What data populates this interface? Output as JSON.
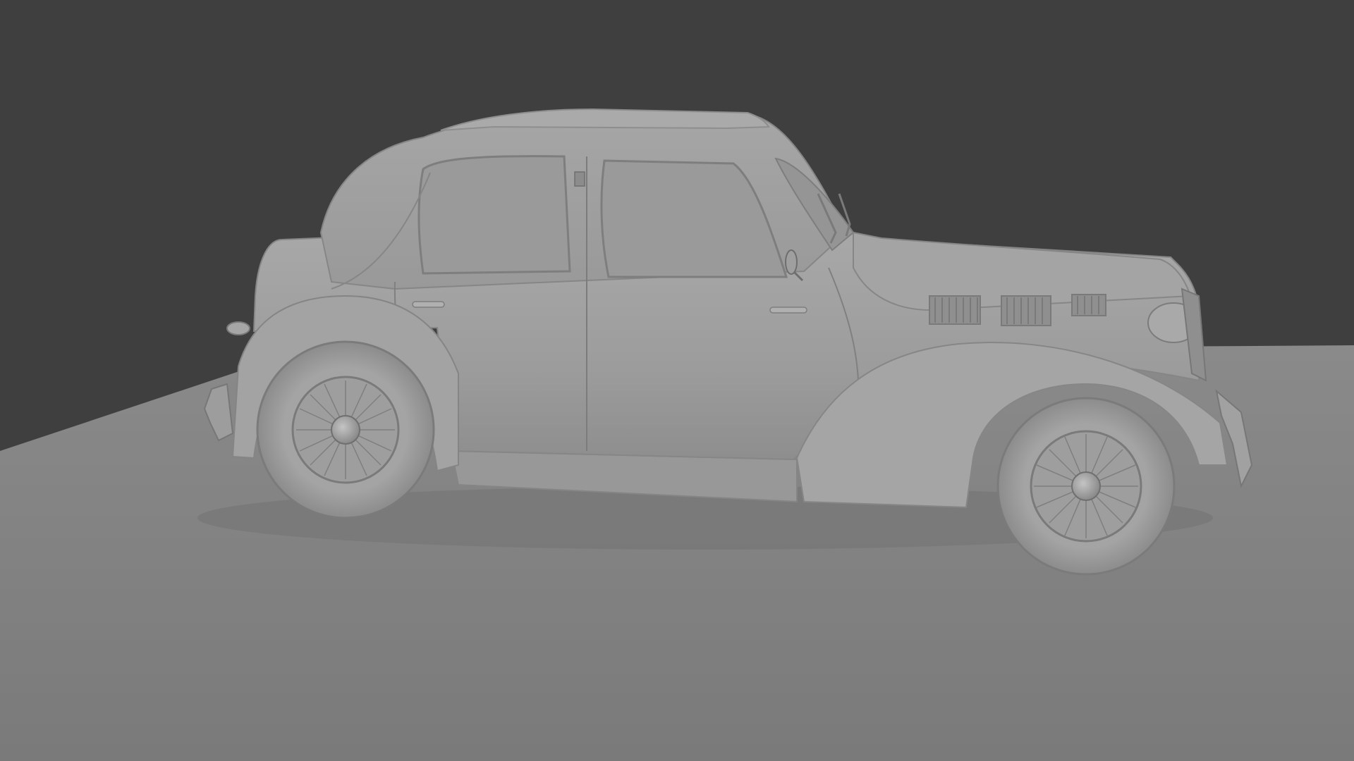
{
  "scene": {
    "background_color": "#3f3f3f",
    "floor_color": "#7d7d7d",
    "model_color": "#9c9c9c"
  }
}
